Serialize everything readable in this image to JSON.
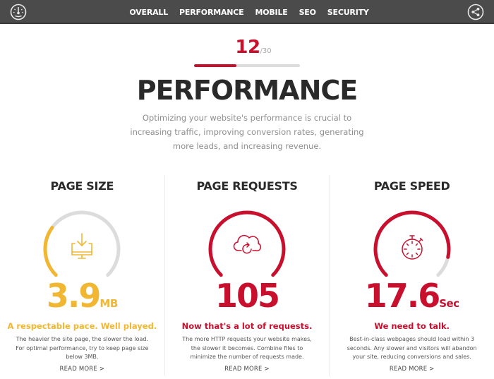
{
  "nav": {
    "left_icon": "speedometer-icon",
    "right_icon": "share-icon",
    "links": [
      "OVERALL",
      "PERFORMANCE",
      "MOBILE",
      "SEO",
      "SECURITY"
    ]
  },
  "score": {
    "value": "12",
    "total": "/30",
    "progress_fraction": 0.4
  },
  "header": {
    "title": "PERFORMANCE",
    "description": "Optimizing your website's performance is crucial to increasing traffic, improving conversion rates, generating more leads, and increasing revenue."
  },
  "colors": {
    "nav_bg": "#4b4b4b",
    "accent_red": "#c8102e",
    "accent_yellow": "#f2b732",
    "track_gray": "#dcdcdc"
  },
  "metrics": [
    {
      "title": "PAGE SIZE",
      "icon": "monitor-download-icon",
      "value": "3.9",
      "unit": "MB",
      "verdict": "A respectable pace. Well played.",
      "detail": "The heavier the site page, the slower the load. For optimal performance, try to keep page size below 3MB.",
      "read_more": "READ MORE >",
      "color": "#f2b732",
      "gauge_fraction": 0.3
    },
    {
      "title": "PAGE REQUESTS",
      "icon": "cloud-refresh-icon",
      "value": "105",
      "unit": "",
      "verdict": "Now that's a lot of requests.",
      "detail": "The more HTTP requests your website makes, the slower it becomes. Combine files to minimize the number of requests made.",
      "read_more": "READ MORE >",
      "color": "#c8102e",
      "gauge_fraction": 1.0
    },
    {
      "title": "PAGE SPEED",
      "icon": "stopwatch-icon",
      "value": "17.6",
      "unit": "Sec",
      "verdict": "We need to talk.",
      "detail": "Best-in-class webpages should load within 3 seconds. Any slower and visitors will abandon your site, reducing conversions and sales.",
      "read_more": "READ MORE >",
      "color": "#c8102e",
      "gauge_fraction": 0.88
    }
  ]
}
